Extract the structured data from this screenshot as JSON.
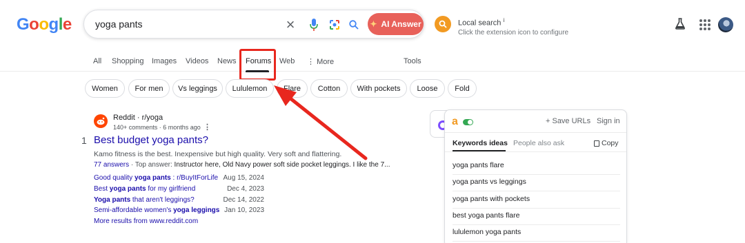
{
  "header": {
    "logo_letters": [
      "G",
      "o",
      "o",
      "g",
      "l",
      "e"
    ],
    "search_query": "yoga pants",
    "ai_answer_label": "AI Answer",
    "local_search": {
      "title": "Local search",
      "info_mark": "i",
      "subtitle": "Click the extension icon to configure"
    }
  },
  "tabs": [
    {
      "label": "All"
    },
    {
      "label": "Shopping"
    },
    {
      "label": "Images"
    },
    {
      "label": "Videos"
    },
    {
      "label": "News"
    },
    {
      "label": "Forums",
      "active": true
    },
    {
      "label": "Web"
    },
    {
      "label": "More",
      "icon": "vertical-dots-icon"
    },
    {
      "label": "Tools"
    }
  ],
  "chips": [
    "Women",
    "For men",
    "Vs leggings",
    "Lululemon",
    "Flare",
    "Cotton",
    "With pockets",
    "Loose",
    "Fold"
  ],
  "result": {
    "number": "1",
    "source": "Reddit · r/yoga",
    "meta": "140+ comments · 6 months ago",
    "title": "Best budget yoga pants?",
    "snippet": "Kamo fitness is the best. Inexpensive but high quality. Very soft and flattering.",
    "answers_link": "77 answers",
    "top_answer_prefix": " · Top answer: ",
    "top_answer": "Instructor here, Old Navy power soft side pocket leggings. I like the 7...",
    "threads": [
      {
        "pre": "Good quality ",
        "bold": "yoga pants",
        "post": " : r/BuyItForLife",
        "date": "Aug 15, 2024"
      },
      {
        "pre": "Best ",
        "bold": "yoga pants",
        "post": " for my girlfriend",
        "date": "Dec 4, 2023"
      },
      {
        "pre": "",
        "bold": "Yoga pants",
        "post": " that aren't leggings?",
        "date": "Dec 14, 2022"
      },
      {
        "pre": "Semi-affordable women's ",
        "bold": "yoga leggings",
        "post": "",
        "date": "Jan 10, 2023"
      }
    ],
    "more_results": "More results from www.reddit.com"
  },
  "side_panel": {
    "logo": "a",
    "save_urls": "+ Save URLs",
    "sign_in": "Sign in",
    "tab_keywords": "Keywords ideas",
    "tab_people": "People also ask",
    "copy_label": "Copy",
    "keywords": [
      "yoga pants flare",
      "yoga pants vs leggings",
      "yoga pants with pockets",
      "best yoga pants flare",
      "lululemon yoga pants"
    ]
  },
  "colors": {
    "link": "#1a0dab",
    "annotation_red": "#e8271e",
    "ai_button": "#e8615a",
    "extension_orange": "#f29a22",
    "reddit": "#ff4500"
  }
}
